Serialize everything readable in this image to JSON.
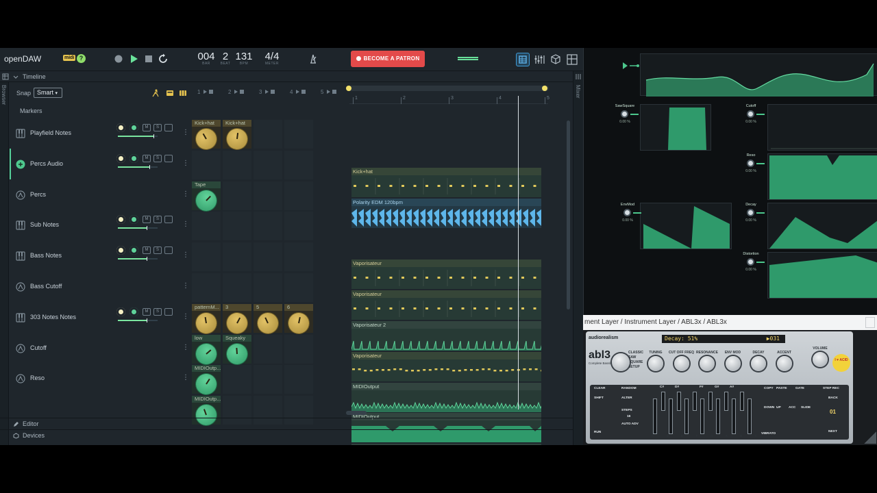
{
  "app": {
    "name": "openDAW",
    "midi_badge": "midi",
    "help": "?"
  },
  "transport": {
    "bar": "004",
    "bar_label": "BAR",
    "beat": "2",
    "beat_label": "BEAT",
    "bpm": "131",
    "bpm_label": "BPM",
    "meter": "4/4",
    "meter_label": "METER"
  },
  "patron_label": "BECOME A PATRON",
  "panel_titles": {
    "timeline": "Timeline",
    "browser": "Browser",
    "mixer": "Mixer",
    "editor": "Editor",
    "devices": "Devices"
  },
  "snap": {
    "label": "Snap",
    "value": "Smart"
  },
  "markers_label": "Markers",
  "scene_numbers": [
    "1",
    "2",
    "3",
    "4",
    "5"
  ],
  "ruler_numbers": [
    "1",
    "2",
    "3",
    "4",
    "5"
  ],
  "mute_label": "M",
  "solo_label": "S",
  "tracks": [
    {
      "name": "Playfield Notes",
      "icon": "piano-icon",
      "controls": true
    },
    {
      "name": "Percs Audio",
      "icon": "audio-icon",
      "controls": true
    },
    {
      "name": "Percs",
      "icon": "automation-icon",
      "controls": false
    },
    {
      "name": "Sub Notes",
      "icon": "piano-icon",
      "controls": true
    },
    {
      "name": "Bass Notes",
      "icon": "piano-icon",
      "controls": true
    },
    {
      "name": "Bass Cutoff",
      "icon": "automation-icon",
      "controls": false
    },
    {
      "name": "303 Notes Notes",
      "icon": "piano-icon",
      "controls": true
    },
    {
      "name": "Cutoff",
      "icon": "automation-icon",
      "controls": false
    },
    {
      "name": "Reso",
      "icon": "automation-icon",
      "controls": false
    }
  ],
  "clips": [
    {
      "label": "Kick+hat",
      "row": 0,
      "col": 0,
      "color": "gold"
    },
    {
      "label": "Kick+hat",
      "row": 0,
      "col": 1,
      "color": "gold"
    },
    {
      "label": "Tape",
      "row": 2,
      "col": 0,
      "color": "green"
    },
    {
      "label": "patternM...",
      "row": 6,
      "col": 0,
      "color": "gold"
    },
    {
      "label": "3",
      "row": 6,
      "col": 1,
      "color": "gold"
    },
    {
      "label": "5",
      "row": 6,
      "col": 2,
      "color": "gold"
    },
    {
      "label": "6",
      "row": 6,
      "col": 3,
      "color": "gold"
    },
    {
      "label": "low",
      "row": 7,
      "col": 0,
      "color": "green"
    },
    {
      "label": "Squeaky",
      "row": 7,
      "col": 1,
      "color": "green"
    },
    {
      "label": "MIDIOutp...",
      "row": 8,
      "col": 0,
      "color": "green"
    },
    {
      "label": "MIDIOutp...",
      "row": 9,
      "col": 0,
      "color": "green"
    }
  ],
  "regions": [
    {
      "label": "Kick+hat",
      "style": "yel",
      "row": 0,
      "pattern": "notes"
    },
    {
      "label": "Polarity EDM 120bpm",
      "style": "blue",
      "row": 1,
      "pattern": "audio"
    },
    {
      "label": "Vaporisateur",
      "style": "yel",
      "row": 3,
      "pattern": "notes"
    },
    {
      "label": "Vaporisateur",
      "style": "yel",
      "row": 4,
      "pattern": "notes"
    },
    {
      "label": "Vaporisateur 2",
      "style": "green",
      "row": 5,
      "pattern": "saw"
    },
    {
      "label": "Vaporisateur",
      "style": "yel",
      "row": 6,
      "pattern": "dense"
    },
    {
      "label": "MIDIOutput",
      "style": "green",
      "row": 7,
      "pattern": "wave"
    },
    {
      "label": "MIDIOutput",
      "style": "green",
      "row": 8,
      "pattern": "dips"
    },
    {
      "label": "MIDIOutput",
      "style": "green",
      "row": 9,
      "pattern": "none"
    }
  ],
  "automation_params": [
    {
      "name": "SawSquare",
      "value": "0.00 %"
    },
    {
      "name": "Cutoff",
      "value": "0.00 %"
    },
    {
      "name": "Reso",
      "value": "0.00 %"
    },
    {
      "name": "EnvMod",
      "value": "0.00 %"
    },
    {
      "name": "Decay",
      "value": "0.00 %"
    },
    {
      "name": "Distortion",
      "value": "0.00 %"
    }
  ],
  "plugin": {
    "window_title": "ment Layer / Instrument Layer / ABL3x / ABL3x",
    "brand": "audiorealism",
    "model": "abl3",
    "model_sub": "Complete Bassline",
    "lcd": "Decay: 51%",
    "lcd_pattern": "▶031",
    "badge": "I ♥ ACID",
    "knob_labels": [
      "TUNING",
      "CUT OFF FREQ",
      "RESONANCE",
      "ENV MOD",
      "DECAY",
      "ACCENT",
      "VOLUME"
    ],
    "waveforms": [
      "CLASSIC",
      "SAW",
      "SQUARE",
      "SETUP"
    ],
    "seq_buttons": [
      "CLEAR",
      "SHIFT",
      "RANDOM",
      "ALTER",
      "STEPS",
      "16",
      "AUTO ADV",
      "RUN",
      "COPY",
      "PASTE",
      "GATE",
      "DOWN",
      "UP",
      "ACC",
      "SLIDE",
      "STEP REC",
      "BACK",
      "01",
      "NEXT",
      "VIBRATO"
    ],
    "sharp_keys": [
      "C#",
      "D#",
      "F#",
      "G#",
      "A#"
    ],
    "keys": [
      "C",
      "D",
      "E",
      "F",
      "G",
      "A",
      "B",
      "C"
    ]
  },
  "colors": {
    "accent_green": "#5fd39a",
    "gold": "#d4b458",
    "patron_red": "#e34a4a",
    "active_tab": "#3e9ddb"
  }
}
